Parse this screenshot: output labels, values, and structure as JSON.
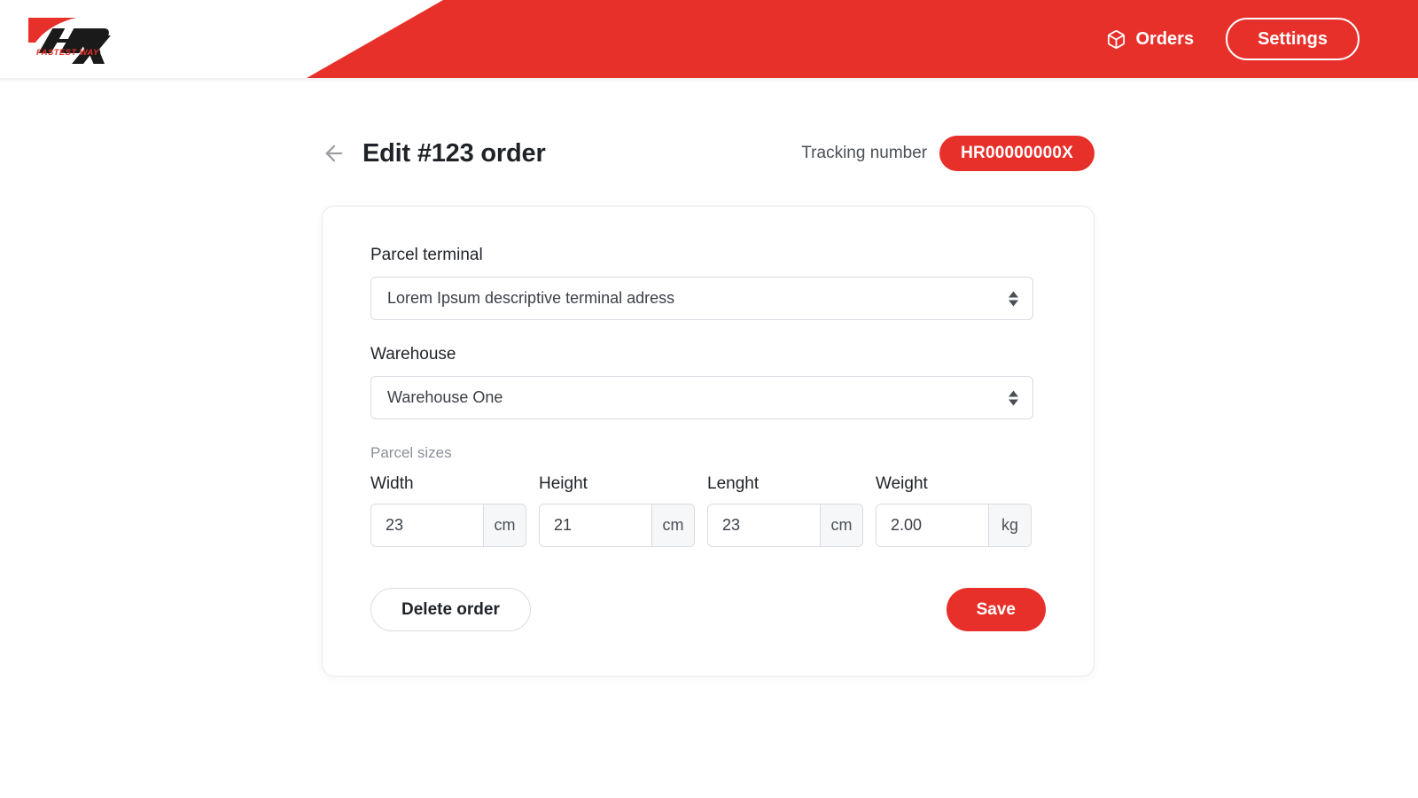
{
  "brand": {
    "logo_text": "HR",
    "logo_accent": "X",
    "tagline": "FASTEST WAY",
    "accent_color": "#E8302A"
  },
  "header": {
    "nav": {
      "orders_label": "Orders",
      "orders_icon": "package-icon",
      "settings_label": "Settings"
    }
  },
  "page": {
    "back_icon": "arrow-left-icon",
    "title": "Edit #123 order",
    "tracking_label": "Tracking number",
    "tracking_number": "HR00000000X"
  },
  "form": {
    "parcel_terminal": {
      "label": "Parcel terminal",
      "value": "Lorem Ipsum descriptive terminal adress",
      "options": [
        "Lorem Ipsum descriptive terminal adress"
      ]
    },
    "warehouse": {
      "label": "Warehouse",
      "value": "Warehouse One",
      "options": [
        "Warehouse One"
      ]
    },
    "parcel_sizes": {
      "caption": "Parcel sizes",
      "fields": [
        {
          "label": "Width",
          "value": "23",
          "unit": "cm"
        },
        {
          "label": "Height",
          "value": "21",
          "unit": "cm"
        },
        {
          "label": "Lenght",
          "value": "23",
          "unit": "cm"
        },
        {
          "label": "Weight",
          "value": "2.00",
          "unit": "kg"
        }
      ]
    }
  },
  "actions": {
    "delete_label": "Delete order",
    "save_label": "Save"
  }
}
